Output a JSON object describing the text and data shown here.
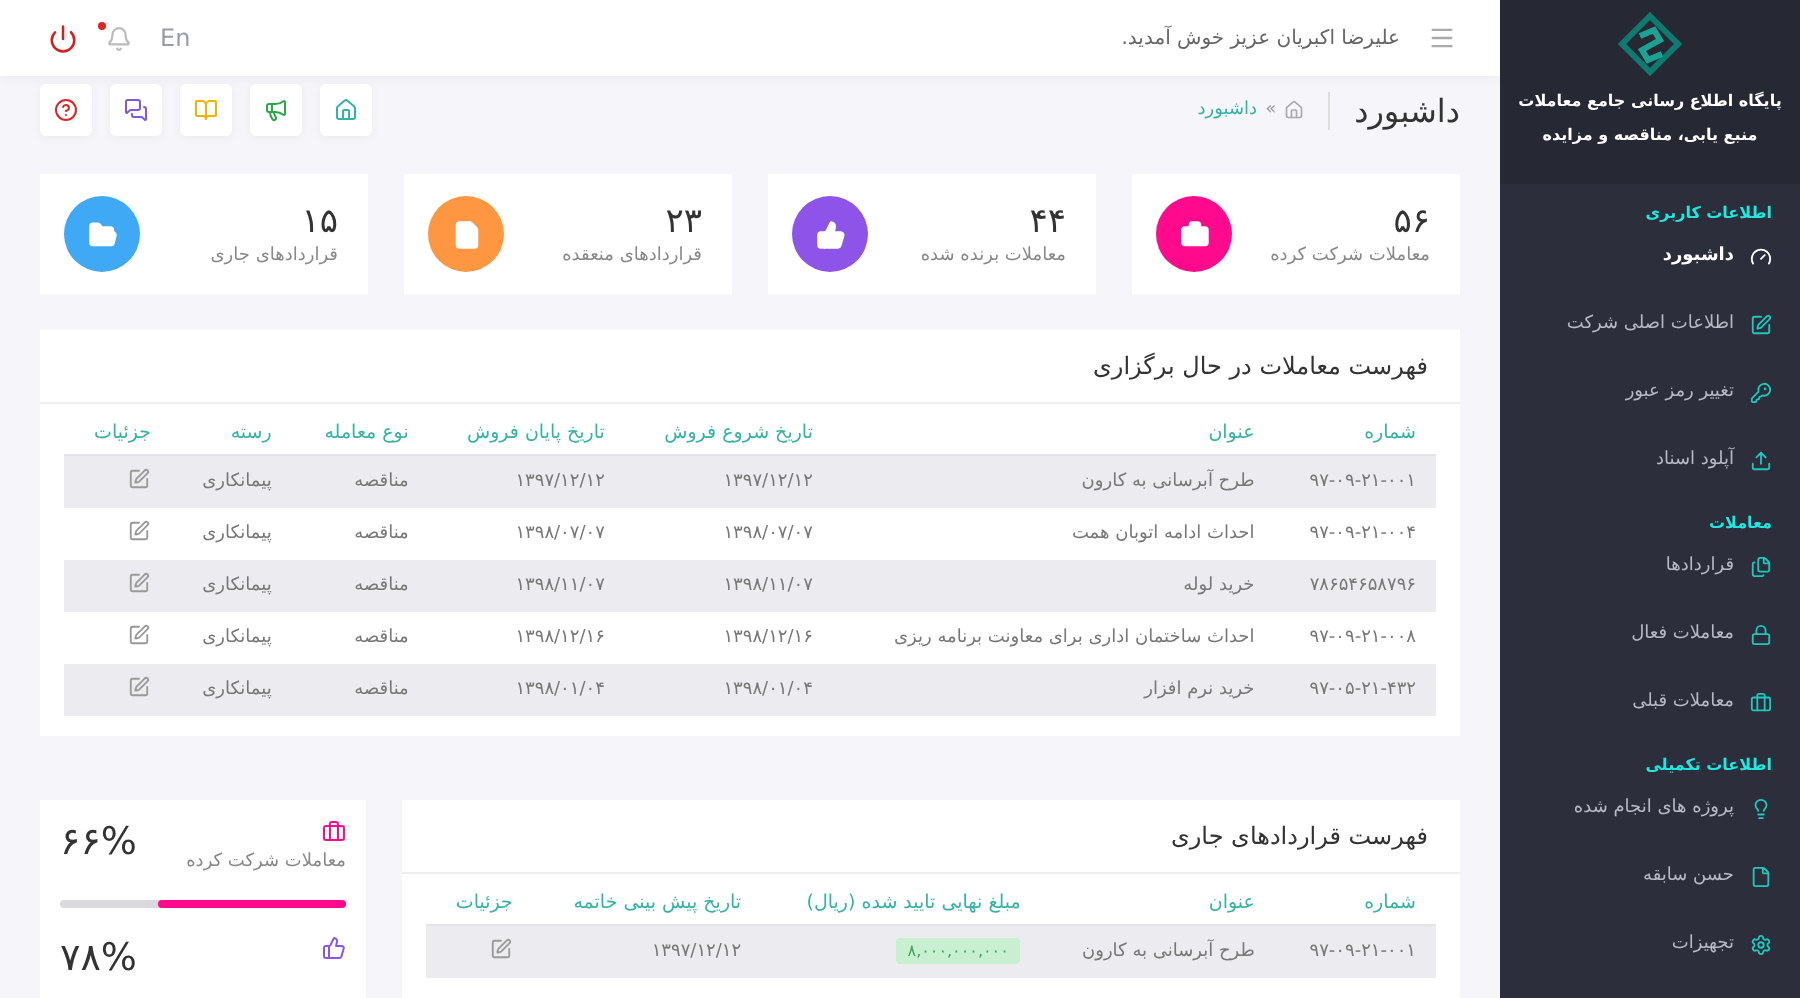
{
  "header": {
    "welcome": "علیرضا اکبریان عزیز خوش آمدید.",
    "language": {
      "label": "En",
      "selected": false
    },
    "notifications_unread": true
  },
  "shortcuts": [
    {
      "kind": "home"
    },
    {
      "kind": "megaphone"
    },
    {
      "kind": "book"
    },
    {
      "kind": "chat"
    },
    {
      "kind": "help"
    }
  ],
  "page": {
    "title": "داشبورد",
    "breadcrumb": "داشبورد",
    "separator": "»"
  },
  "stats": [
    {
      "value": "۵۶",
      "label": "معاملات شرکت کرده",
      "kind": "briefcase",
      "color": "#ff0a8c"
    },
    {
      "value": "۴۴",
      "label": "معاملات برنده شده",
      "kind": "thumbs",
      "color": "#8e54e9"
    },
    {
      "value": "۲۳",
      "label": "قراردادهای منعقده",
      "kind": "file",
      "color": "#ff9642"
    },
    {
      "value": "۱۵",
      "label": "قراردادهای جاری",
      "kind": "folder",
      "color": "#3fa9f5"
    }
  ],
  "deals_table": {
    "title": "فهرست معاملات در حال برگزاری",
    "columns": [
      "شماره",
      "عنوان",
      "تاریخ شروع فروش",
      "تاریخ پایان فروش",
      "نوع معامله",
      "رسته",
      "جزئیات"
    ],
    "rows": [
      [
        "۹۷-۰۹-۲۱-۰۰۱",
        "طرح آبرسانی به کارون",
        "۱۳۹۷/۱۲/۱۲",
        "۱۳۹۷/۱۲/۱۲",
        "مناقصه",
        "پیمانکاری"
      ],
      [
        "۹۷-۰۹-۲۱-۰۰۴",
        "احداث ادامه اتوبان همت",
        "۱۳۹۸/۰۷/۰۷",
        "۱۳۹۸/۰۷/۰۷",
        "مناقصه",
        "پیمانکاری"
      ],
      [
        "۷۸۶۵۴۶۵۸۷۹۶",
        "خرید لوله",
        "۱۳۹۸/۱۱/۰۷",
        "۱۳۹۸/۱۱/۰۷",
        "مناقصه",
        "پیمانکاری"
      ],
      [
        "۹۷-۰۹-۲۱-۰۰۸",
        "احداث ساختمان اداری برای معاونت برنامه ریزی",
        "۱۳۹۸/۱۲/۱۶",
        "۱۳۹۸/۱۲/۱۶",
        "مناقصه",
        "پیمانکاری"
      ],
      [
        "۹۷-۰۵-۲۱-۴۳۲",
        "خرید نرم افزار",
        "۱۳۹۸/۰۱/۰۴",
        "۱۳۹۸/۰۱/۰۴",
        "مناقصه",
        "پیمانکاری"
      ]
    ]
  },
  "progress": [
    {
      "value": "۶۶%",
      "label": "معاملات شرکت کرده",
      "kind": "briefcase",
      "color": "#ff0a8c",
      "level": 0.66
    },
    {
      "value": "۷۸%",
      "kind": "thumbs",
      "color": "#8e54e9"
    }
  ],
  "contracts_table": {
    "title": "فهرست قراردادهای جاری",
    "columns": [
      "شماره",
      "عنوان",
      "مبلغ نهایی تایید شده (ریال)",
      "تاریخ پیش بینی خاتمه",
      "جزئیات"
    ],
    "rows": [
      [
        "۹۷-۰۹-۲۱-۰۰۱",
        "طرح آبرسانی به کارون",
        "۸,۰۰۰,۰۰۰,۰۰۰",
        "۱۳۹۷/۱۲/۱۲"
      ]
    ]
  },
  "sidebar": {
    "brand": [
      "پایگاه اطلاع رسانی جامع معاملات",
      "منبع یابی، مناقصه و مزایده"
    ],
    "sections": [
      {
        "title": "اطلاعات کاربری",
        "items": [
          {
            "label": "داشبورد",
            "kind": "gauge",
            "selected": true
          },
          {
            "label": "اطلاعات اصلی شرکت",
            "kind": "edit",
            "selected": false
          },
          {
            "label": "تغییر رمز عبور",
            "kind": "key",
            "selected": false
          },
          {
            "label": "آپلود اسناد",
            "kind": "upload",
            "selected": false
          }
        ]
      },
      {
        "title": "معاملات",
        "items": [
          {
            "label": "قراردادها",
            "kind": "files",
            "selected": false
          },
          {
            "label": "معاملات فعال",
            "kind": "lock",
            "selected": false
          },
          {
            "label": "معاملات قبلی",
            "kind": "briefcase",
            "selected": false
          }
        ]
      },
      {
        "title": "اطلاعات تکمیلی",
        "items": [
          {
            "label": "پروژه های انجام شده",
            "kind": "bulb",
            "selected": false
          },
          {
            "label": "حسن سابقه",
            "kind": "file",
            "selected": false
          },
          {
            "label": "تجهیزات",
            "kind": "gear",
            "selected": false
          }
        ]
      }
    ]
  }
}
